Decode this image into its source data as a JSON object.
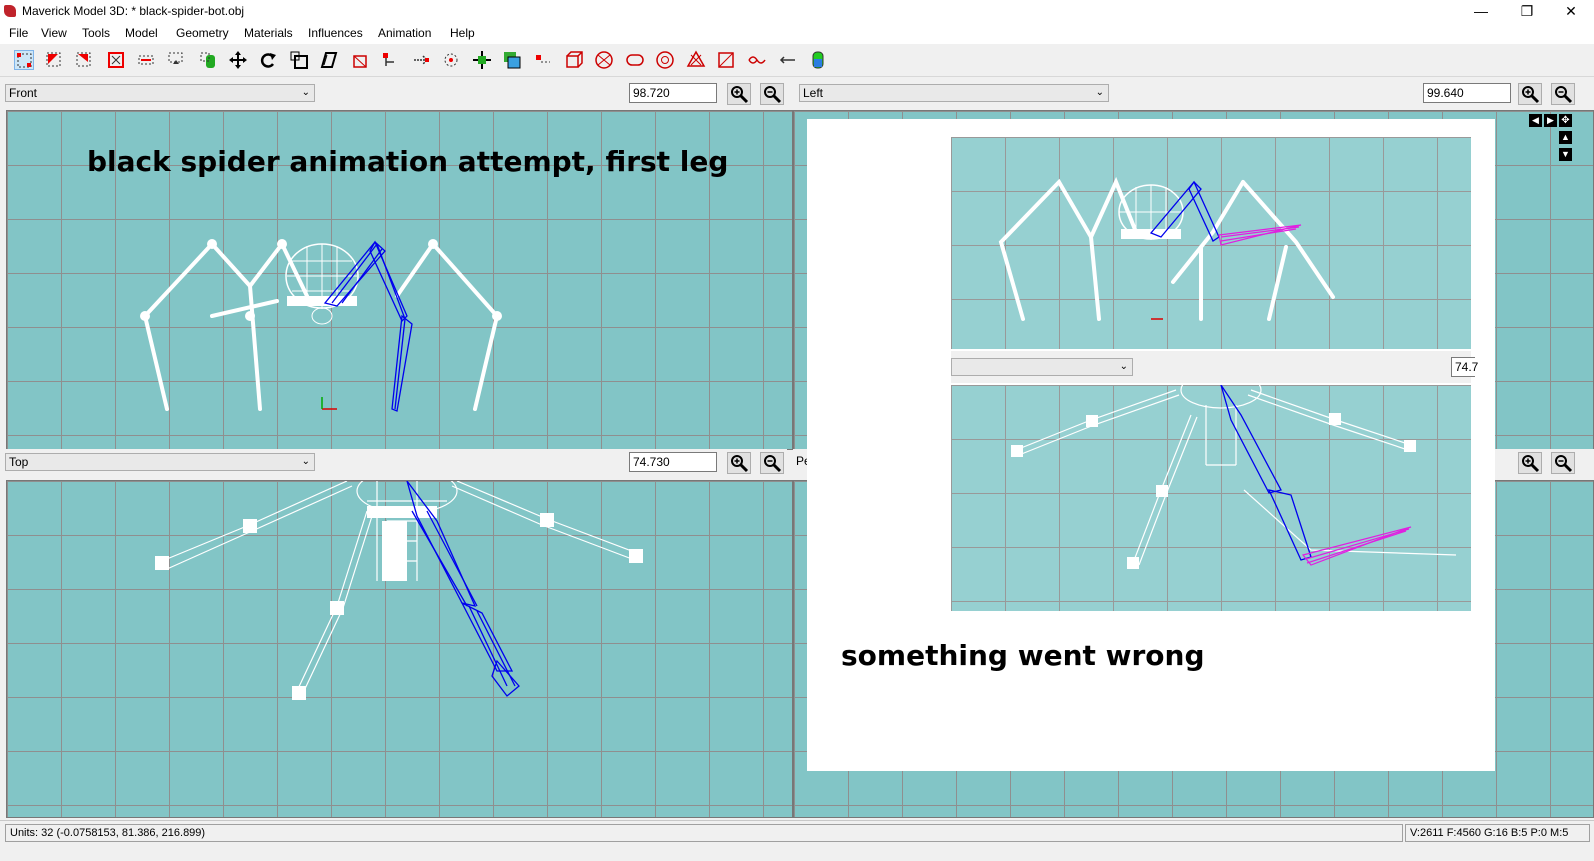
{
  "window": {
    "title": "Maverick Model 3D: * black-spider-bot.obj",
    "minimize": "—",
    "maximize": "❐",
    "close": "✕"
  },
  "menu": [
    "File",
    "View",
    "Tools",
    "Model",
    "Geometry",
    "Materials",
    "Influences",
    "Animation",
    "Help"
  ],
  "viewports": {
    "front": {
      "view": "Front",
      "zoom": "98.720"
    },
    "left": {
      "view": "Left",
      "zoom": "99.640"
    },
    "top": {
      "view": "Top",
      "zoom": "74.730"
    },
    "persp": {
      "view": "Pe"
    }
  },
  "captions": {
    "main": "black spider animation attempt, first leg",
    "overlay": "something went wrong",
    "overlay_zoom": "74.7"
  },
  "status": {
    "units": "Units: 32  (-0.0758153, 81.386, 216.899)",
    "counts": "V:2611 F:4560 G:16 B:5 P:0 M:5"
  },
  "colors": {
    "viewport_bg": "#82c5c6",
    "bone_blue": "#0000ff",
    "bone_magenta": "#e020e0",
    "wire": "#ffffff"
  }
}
